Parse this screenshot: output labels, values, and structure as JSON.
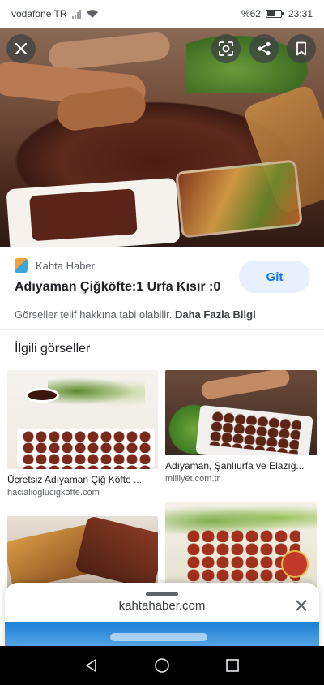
{
  "status_bar": {
    "carrier": "vodafone TR",
    "battery": "%62",
    "time": "23:31"
  },
  "hero": {
    "icons": [
      "close-icon",
      "lens-icon",
      "share-icon",
      "bookmark-icon"
    ]
  },
  "source": {
    "name": "Kahta Haber",
    "logo": "kahta-haber-logo"
  },
  "result": {
    "title": "Adıyaman Çiğköfte:1 Urfa Kısır :0",
    "visit_label": "Git"
  },
  "copyright": {
    "notice": "Görseller telif hakkına tabi olabilir.",
    "more_info": "Daha Fazla Bilgi"
  },
  "related": {
    "heading": "İlgili görseller",
    "items": [
      {
        "title": "Ücretsiz Adıyaman Çiğ Köfte ...",
        "source": "hacialioglucigkofte.com"
      },
      {
        "title": "Adıyaman, Şanlıurfa ve Elazığ...",
        "source": "milliyet.com.tr"
      },
      {
        "title": "",
        "source": ""
      },
      {
        "title": "",
        "source": ""
      }
    ]
  },
  "sheet": {
    "domain": "kahtahaber.com"
  },
  "colors": {
    "accent": "#1a73e8",
    "button_bg": "#e8f0fe",
    "text": "#202124",
    "muted": "#5f6368"
  }
}
